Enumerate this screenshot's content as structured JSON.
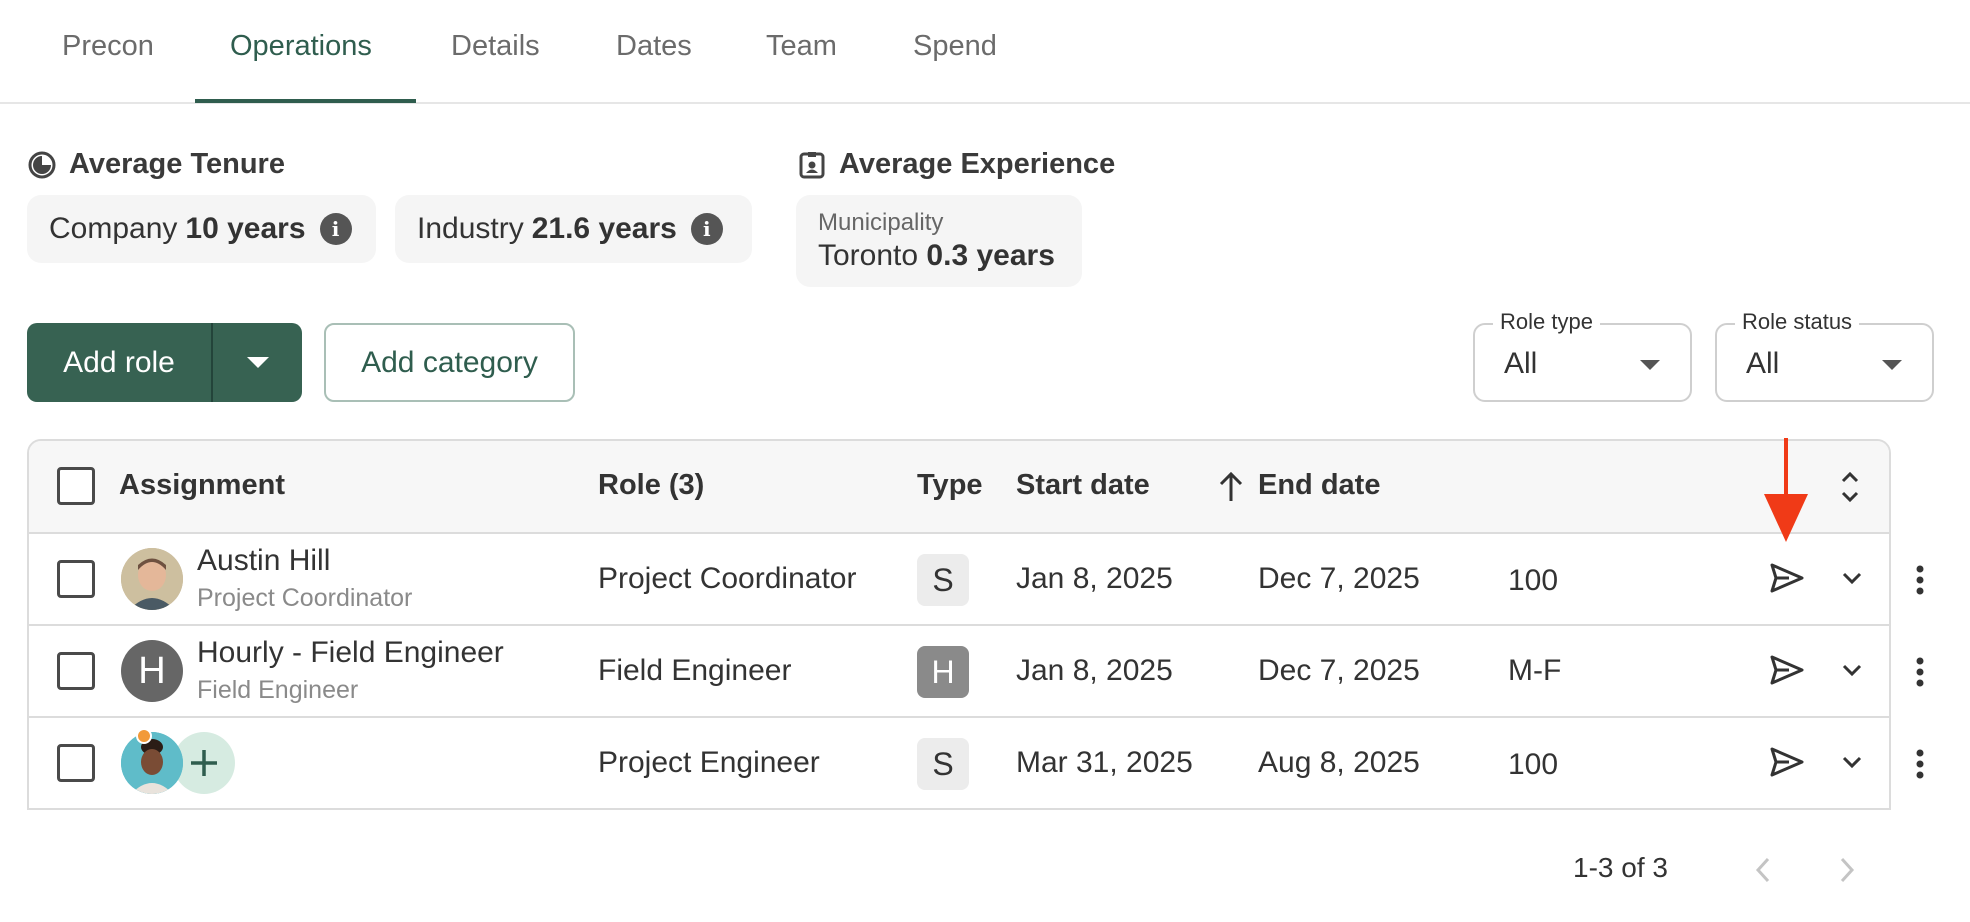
{
  "tabs": [
    {
      "label": "Precon"
    },
    {
      "label": "Operations"
    },
    {
      "label": "Details"
    },
    {
      "label": "Dates"
    },
    {
      "label": "Team"
    },
    {
      "label": "Spend"
    }
  ],
  "tenure": {
    "title": "Average Tenure",
    "company_label": "Company",
    "company_value": "10 years",
    "industry_label": "Industry",
    "industry_value": "21.6 years",
    "info_glyph": "i"
  },
  "experience": {
    "title": "Average Experience",
    "label": "Municipality",
    "city": "Toronto",
    "value": "0.3 years"
  },
  "actions": {
    "add_role": "Add role",
    "add_category": "Add category"
  },
  "filters": {
    "role_type_label": "Role type",
    "role_type_value": "All",
    "role_status_label": "Role status",
    "role_status_value": "All"
  },
  "table": {
    "headers": {
      "assignment": "Assignment",
      "role": "Role (3)",
      "type": "Type",
      "start": "Start date",
      "end": "End date"
    },
    "rows": [
      {
        "name": "Austin Hill",
        "subtitle": "Project Coordinator",
        "role": "Project Coordinator",
        "type": "S",
        "start": "Jan 8, 2025",
        "end": "Dec 7, 2025",
        "allocation": "100"
      },
      {
        "name": "Hourly - Field Engineer",
        "subtitle": "Field Engineer",
        "avatar_letter": "H",
        "role": "Field Engineer",
        "type": "H",
        "start": "Jan 8, 2025",
        "end": "Dec 7, 2025",
        "allocation": "M-F"
      },
      {
        "name": "",
        "subtitle": "",
        "role": "Project Engineer",
        "type": "S",
        "start": "Mar 31, 2025",
        "end": "Aug 8, 2025",
        "allocation": "100"
      }
    ]
  },
  "pagination": {
    "range": "1-3 of 3"
  },
  "colors": {
    "brand": "#376252",
    "annotation_arrow": "#f03a17"
  },
  "icons": [
    "tenure-clock-icon",
    "badge-icon",
    "info-icon",
    "send-icon",
    "chevron-down-icon",
    "more-vert-icon",
    "sort-arrow-up-icon",
    "unfold-icon",
    "chevron-left-icon",
    "chevron-right-icon",
    "add-icon"
  ]
}
